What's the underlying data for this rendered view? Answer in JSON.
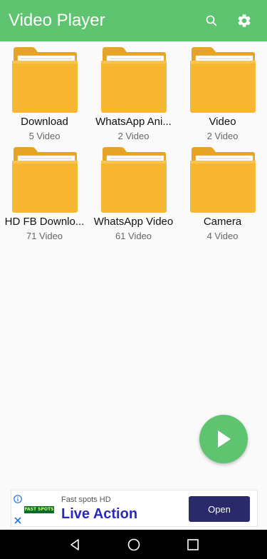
{
  "app_bar": {
    "title": "Video Player",
    "search_icon": "search-icon",
    "settings_icon": "gear-icon",
    "background_color": "#5fc46f"
  },
  "folders": [
    {
      "name": "Download",
      "count": "5 Video"
    },
    {
      "name": "WhatsApp Ani...",
      "count": "2 Video"
    },
    {
      "name": "Video",
      "count": "2 Video"
    },
    {
      "name": "HD FB Downlo...",
      "count": "71 Video"
    },
    {
      "name": "WhatsApp Video",
      "count": "61 Video"
    },
    {
      "name": "Camera",
      "count": "4 Video"
    }
  ],
  "fab": {
    "icon": "play-icon",
    "color": "#5fc46f"
  },
  "ad": {
    "logo_text": "FAST SPOTS",
    "sponsor": "Fast spots HD",
    "headline": "Live Action",
    "cta": "Open",
    "cta_color": "#2a2969",
    "headline_color": "#2b2ab2"
  },
  "nav_bar": {
    "back_icon": "back-icon",
    "home_icon": "home-icon",
    "recents_icon": "recents-icon"
  }
}
